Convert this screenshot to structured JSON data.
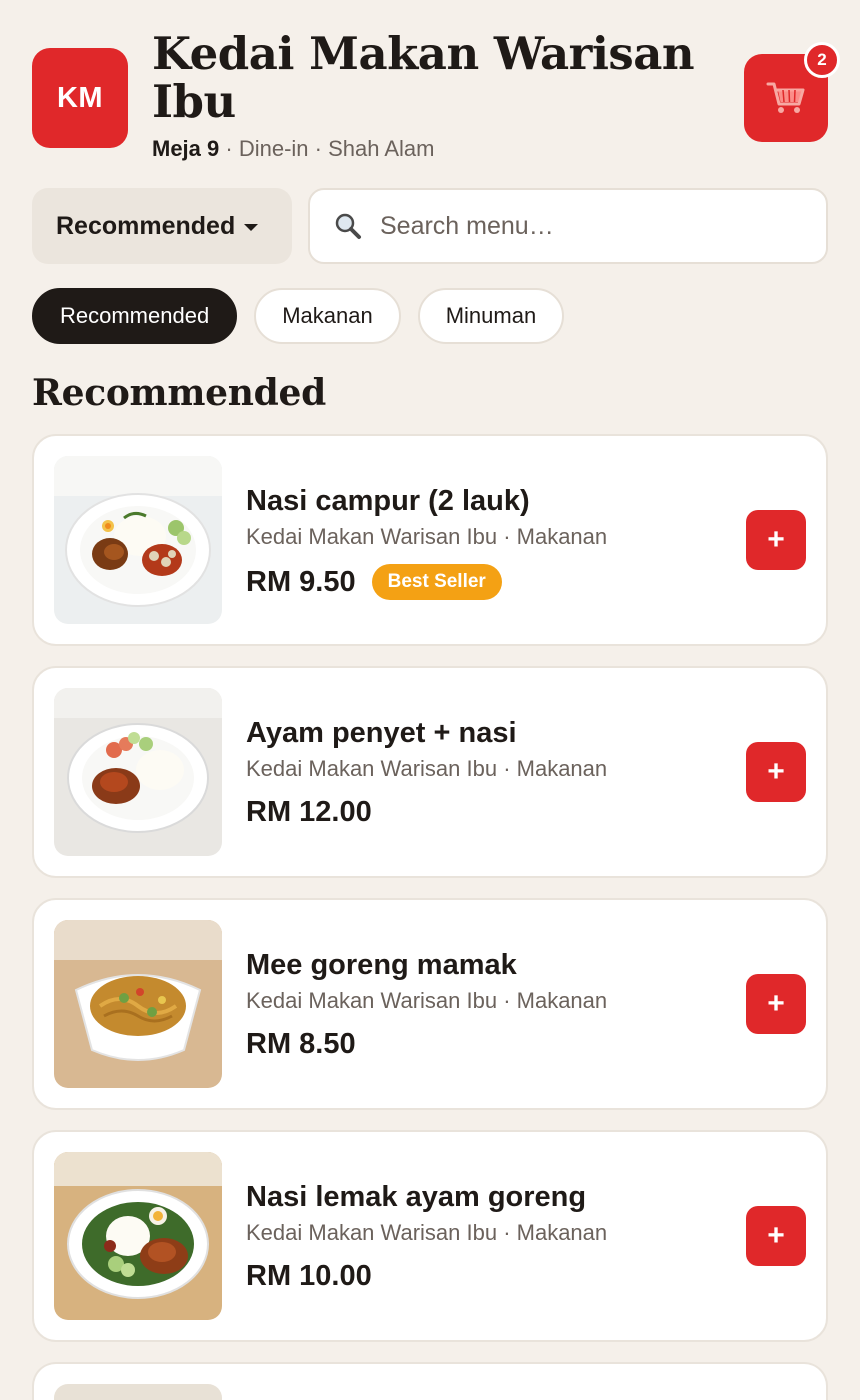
{
  "header": {
    "logo_text": "KM",
    "store_name": "Kedai Makan Warisan Ibu",
    "table_label": "Meja 9",
    "sub_info": " · Dine-in · Shah Alam",
    "cart_count": "2",
    "cart_icon": "shopping-cart-icon"
  },
  "toolbar": {
    "sort_label": "Recommended",
    "search_placeholder": "Search menu…",
    "search_value": "",
    "search_icon": "magnifier-icon"
  },
  "categories": [
    {
      "label": "Recommended",
      "active": true
    },
    {
      "label": "Makanan",
      "active": false
    },
    {
      "label": "Minuman",
      "active": false
    }
  ],
  "section_title": "Recommended",
  "items": [
    {
      "name": "Nasi campur (2 lauk)",
      "meta": "Kedai Makan Warisan Ibu · Makanan",
      "price": "RM 9.50",
      "badge": "Best Seller",
      "add_label": "+"
    },
    {
      "name": "Ayam penyet + nasi",
      "meta": "Kedai Makan Warisan Ibu · Makanan",
      "price": "RM 12.00",
      "badge": "",
      "add_label": "+"
    },
    {
      "name": "Mee goreng mamak",
      "meta": "Kedai Makan Warisan Ibu · Makanan",
      "price": "RM 8.50",
      "badge": "",
      "add_label": "+"
    },
    {
      "name": "Nasi lemak ayam goreng",
      "meta": "Kedai Makan Warisan Ibu · Makanan",
      "price": "RM 10.00",
      "badge": "",
      "add_label": "+"
    }
  ],
  "colors": {
    "accent": "#e0282a",
    "badge": "#f4a114",
    "background": "#f5f0ea"
  }
}
